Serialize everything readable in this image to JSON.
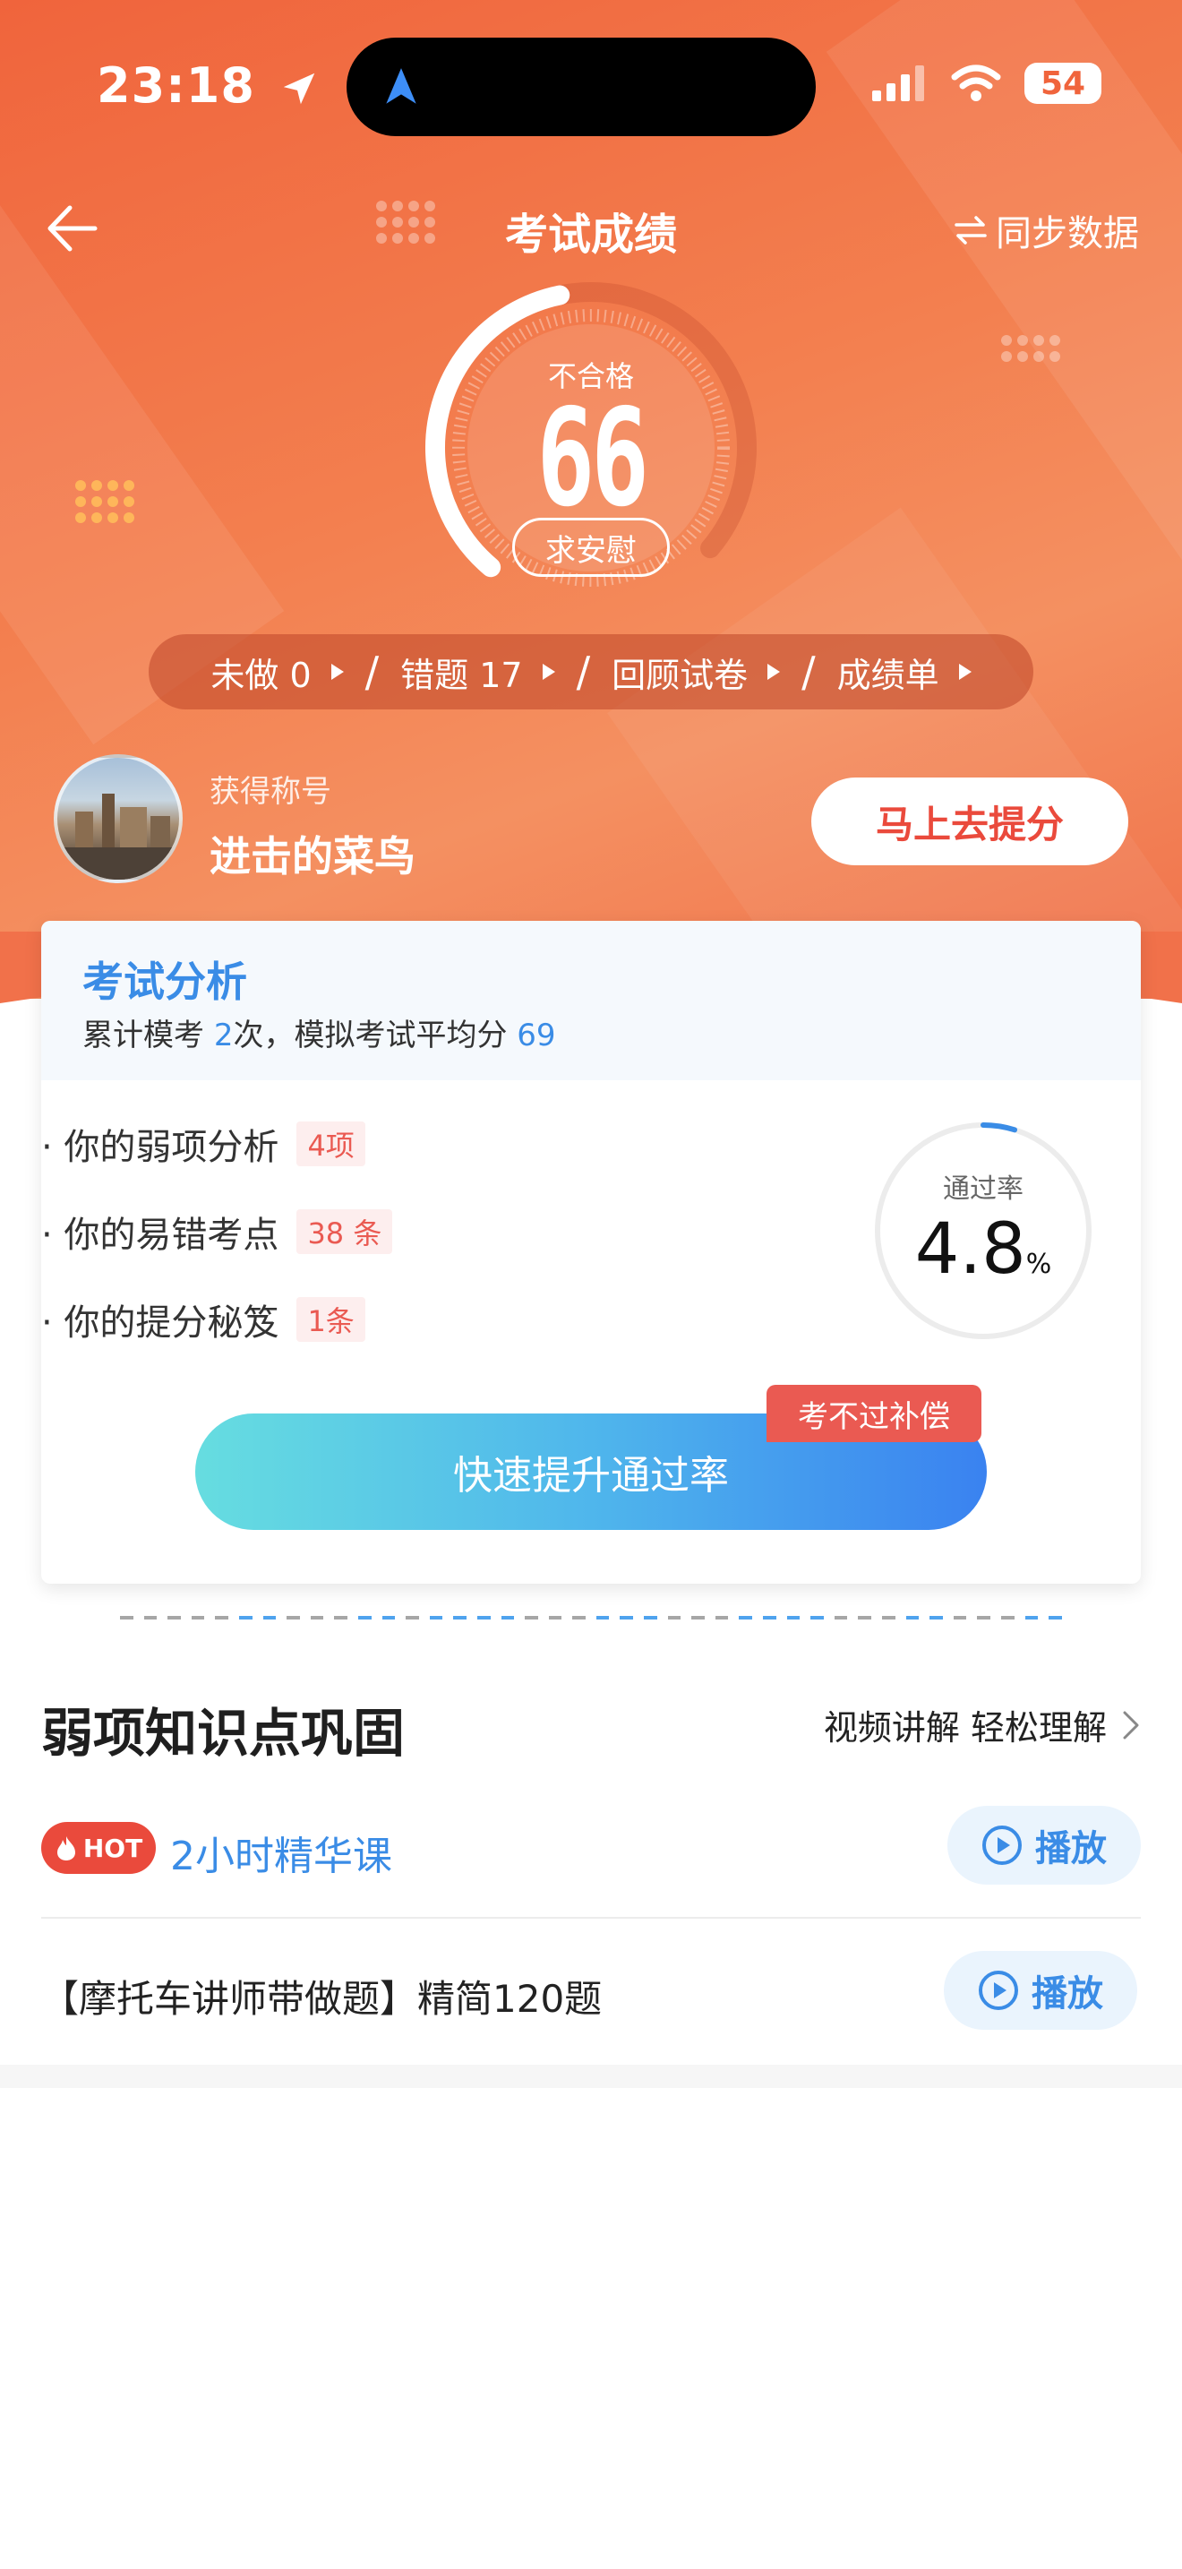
{
  "status_bar": {
    "time": "23:18",
    "battery": "54"
  },
  "header": {
    "title": "考试成绩",
    "sync_label": "同步数据"
  },
  "score": {
    "status": "不合格",
    "value": "66",
    "comfort_label": "求安慰"
  },
  "shortcuts": [
    {
      "label": "未做 0"
    },
    {
      "label": "错题 17"
    },
    {
      "label": "回顾试卷"
    },
    {
      "label": "成绩单"
    }
  ],
  "profile": {
    "title_label": "获得称号",
    "title_name": "进击的菜鸟",
    "boost_button": "马上去提分"
  },
  "analysis": {
    "title": "考试分析",
    "sub_prefix": "累计模考",
    "exam_count": "2",
    "sub_middle": "次，模拟考试平均分",
    "average": "69",
    "items": [
      {
        "label": "· 你的弱项分析",
        "tag": "4项"
      },
      {
        "label": "· 你的易错考点",
        "tag": "38 条"
      },
      {
        "label": "· 你的提分秘笈",
        "tag": "1条"
      }
    ],
    "pass_rate_label": "通过率",
    "pass_rate_value": "4.8",
    "pass_rate_unit": "%",
    "pass_rate_fraction": 0.048,
    "fast_button": "快速提升通过率",
    "compensation_badge": "考不过补偿"
  },
  "weak_points": {
    "title": "弱项知识点巩固",
    "more": "视频讲解 轻松理解",
    "courses": [
      {
        "badge": "HOT",
        "title": "2小时精华课",
        "play": "播放"
      },
      {
        "title": "【摩托车讲师带做题】精简120题",
        "play": "播放"
      }
    ]
  },
  "colors": {
    "brand": "#f0643c",
    "blue": "#3a8ce6",
    "red": "#ea4a3c"
  }
}
